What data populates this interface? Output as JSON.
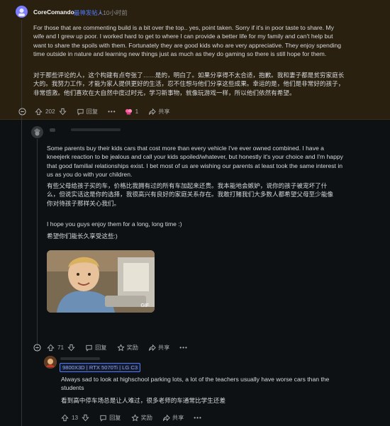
{
  "comment1": {
    "username": "CoreComando",
    "flair": "最神发帖人",
    "time": "• 10小时前",
    "text_en": "For those that are commenting build is a bit over the top.. yes, point taken. Sorry if it's in poor taste to share. My wife and I grew up poor. I worked hard to get to where I can provide a better life for my family and can't help but want to share the spoils with them. Fortunately they are good kids who are very appreciative. They enjoy spending time outside in nature and learning new things just as much as they do gaming so there is still hope for them.",
    "text_zh": "对于那些评论的人，这个构建有点夸张了……是的，明白了。如果分享得不太合适，抱歉。我和妻子都是贫穷家庭长大的。我努力工作，才能为家人提供更好的生活，忍不住想与他们分享这些成果。幸运的是，他们是非常好的孩子，非常感激。他们喜欢在大自然中度过时光，学习新事物，就像玩游戏一样，所以他们依然有希望。",
    "votes": "202",
    "reply": "回复",
    "award_count": "1",
    "share": "共享"
  },
  "comment2": {
    "p1": "Some parents buy their kids cars that cost more than every vehicle I've ever owned combined. I have a kneejerk reaction to be jealous and call your kids spoiled/whatever, but honestly it's your choice and I'm happy that good familial relationships exist. I bet most of us are wishing our parents at least took the same interest in us as you do with your children.",
    "p1_zh": "有些父母给孩子买的车，价格比我拥有过的所有车加起来还贵。我本能地会嫉妒，说你的孩子被宠坏了什么，但说实话这是你的选择，我很高兴有良好的家庭关系存在。我敢打赌我们大多数人都希望父母至少能像你对待孩子那样关心我们。",
    "p2": "I hope you guys enjoy them for a long, long time :)",
    "p2_zh": "希望你们能长久享受这些:)",
    "gif_badge": "GIF",
    "votes": "71",
    "reply": "回复",
    "award": "奖励",
    "share": "共享"
  },
  "comment3": {
    "flair": "9800X3D | RTX 5070Ti | LG C3",
    "text_en": "Always sad to look at highschool parking lots, a lot of the teachers usually have worse cars than the students",
    "text_zh": "看到高中停车场总是让人难过，很多老师的车通常比学生还差",
    "votes": "13",
    "reply": "回复",
    "award": "奖励",
    "share": "共享"
  },
  "colors": {
    "accent": "#4f7cff",
    "highlight_bg": "#2a2010",
    "bg": "#0e1113"
  }
}
